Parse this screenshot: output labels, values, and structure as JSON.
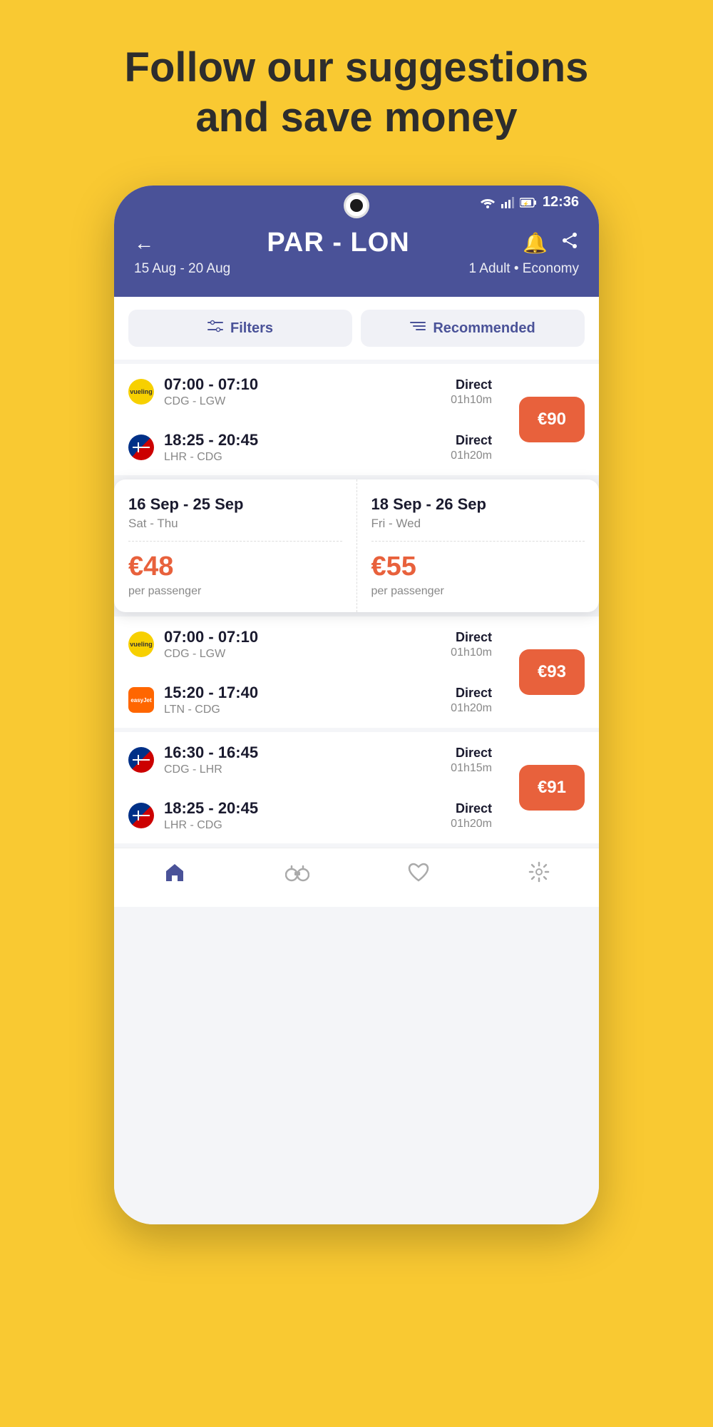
{
  "page": {
    "background_color": "#F9C932",
    "headline_line1": "Follow our suggestions",
    "headline_line2": "and save money"
  },
  "status_bar": {
    "time": "12:36"
  },
  "app_header": {
    "back_label": "←",
    "route": "PAR - LON",
    "dates": "15 Aug - 20 Aug",
    "passengers": "1 Adult • Economy"
  },
  "filter_bar": {
    "filters_label": "Filters",
    "recommended_label": "Recommended"
  },
  "flights": [
    {
      "id": "f1",
      "outbound_time": "07:00 - 07:10",
      "outbound_airports": "CDG - LGW",
      "outbound_type": "Direct",
      "outbound_duration": "01h10m",
      "airline_out": "vueling",
      "inbound_time": "18:25 - 20:45",
      "inbound_airports": "LHR - CDG",
      "inbound_type": "Direct",
      "inbound_duration": "01h20m",
      "airline_in": "british",
      "price": "€90"
    }
  ],
  "suggestions": [
    {
      "date1": "16 Sep - 25 Sep",
      "day1": "Sat - Thu",
      "price1": "€48",
      "pp1": "per passenger",
      "date2": "18 Sep - 26 Sep",
      "day2": "Fri - Wed",
      "price2": "€55",
      "pp2": "per passenger"
    }
  ],
  "flights2": [
    {
      "id": "f2",
      "outbound_time": "07:00 - 07:10",
      "outbound_airports": "CDG - LGW",
      "outbound_type": "Direct",
      "outbound_duration": "01h10m",
      "airline_out": "vueling",
      "inbound_time": "15:20 - 17:40",
      "inbound_airports": "LTN - CDG",
      "inbound_type": "Direct",
      "inbound_duration": "01h20m",
      "airline_in": "easyjet",
      "price": "€93"
    },
    {
      "id": "f3",
      "outbound_time": "16:30 - 16:45",
      "outbound_airports": "CDG - LHR",
      "outbound_type": "Direct",
      "outbound_duration": "01h15m",
      "airline_out": "british",
      "inbound_time": "18:25 - 20:45",
      "inbound_airports": "LHR - CDG",
      "inbound_type": "Direct",
      "inbound_duration": "01h20m",
      "airline_in": "british",
      "price": "€91"
    }
  ],
  "bottom_nav": {
    "home_label": "home",
    "search_label": "search",
    "favorites_label": "favorites",
    "settings_label": "settings"
  }
}
